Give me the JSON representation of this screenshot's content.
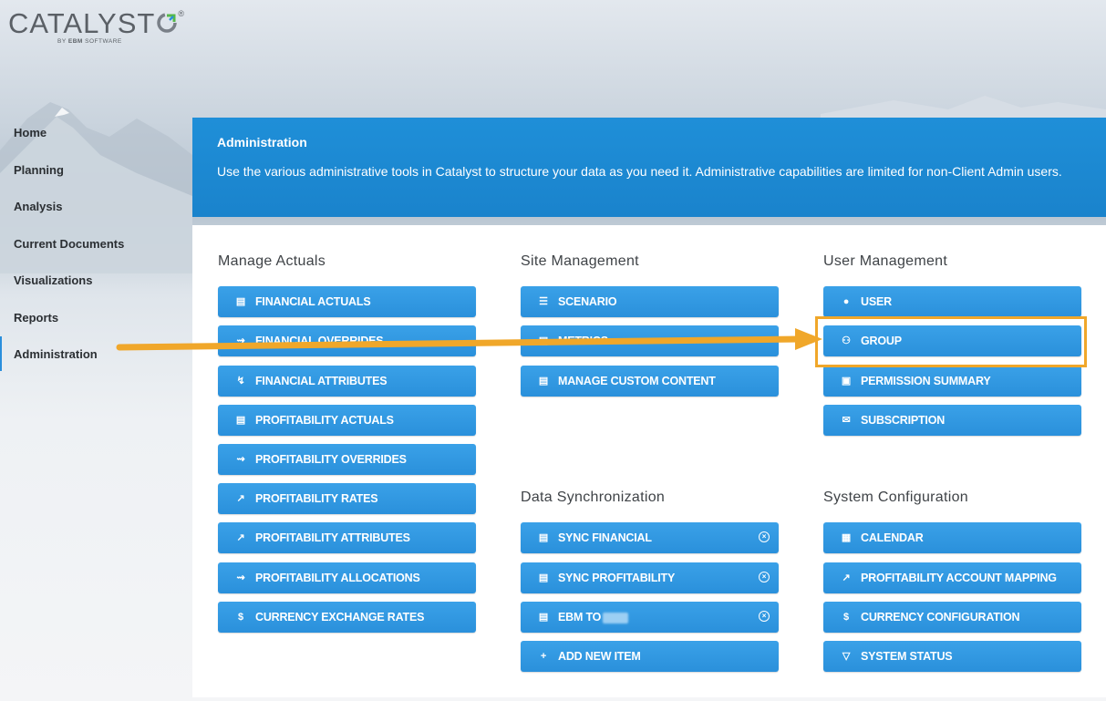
{
  "brand": {
    "name": "CATALYST",
    "registered": "®",
    "byline_prefix": "BY",
    "byline_company": "EBM",
    "byline_suffix": "SOFTWARE"
  },
  "sidebar": {
    "items": [
      {
        "label": "Home"
      },
      {
        "label": "Planning"
      },
      {
        "label": "Analysis"
      },
      {
        "label": "Current Documents"
      },
      {
        "label": "Visualizations"
      },
      {
        "label": "Reports"
      },
      {
        "label": "Administration"
      }
    ],
    "active": "Administration"
  },
  "header": {
    "title": "Administration",
    "description": "Use the various administrative tools in Catalyst to structure your data as you need it. Administrative capabilities are limited for non-Client Admin users."
  },
  "sections": {
    "manage_actuals": {
      "title": "Manage Actuals",
      "items": [
        {
          "label": "FINANCIAL ACTUALS",
          "icon": "list-icon"
        },
        {
          "label": "FINANCIAL OVERRIDES",
          "icon": "override-icon"
        },
        {
          "label": "FINANCIAL ATTRIBUTES",
          "icon": "attribute-icon"
        },
        {
          "label": "PROFITABILITY ACTUALS",
          "icon": "list-icon"
        },
        {
          "label": "PROFITABILITY OVERRIDES",
          "icon": "override-icon"
        },
        {
          "label": "PROFITABILITY RATES",
          "icon": "trend-icon"
        },
        {
          "label": "PROFITABILITY ATTRIBUTES",
          "icon": "trend-icon"
        },
        {
          "label": "PROFITABILITY ALLOCATIONS",
          "icon": "override-icon"
        },
        {
          "label": "CURRENCY EXCHANGE RATES",
          "icon": "currency-icon"
        }
      ]
    },
    "site_management": {
      "title": "Site Management",
      "items": [
        {
          "label": "SCENARIO",
          "icon": "scenario-icon"
        },
        {
          "label": "METRICS",
          "icon": "list-icon"
        },
        {
          "label": "MANAGE CUSTOM CONTENT",
          "icon": "list-icon"
        }
      ]
    },
    "user_management": {
      "title": "User Management",
      "items": [
        {
          "label": "USER",
          "icon": "user-icon"
        },
        {
          "label": "GROUP",
          "icon": "group-icon"
        },
        {
          "label": "PERMISSION SUMMARY",
          "icon": "permission-icon"
        },
        {
          "label": "SUBSCRIPTION",
          "icon": "subscription-icon"
        }
      ]
    },
    "data_sync": {
      "title": "Data Synchronization",
      "items": [
        {
          "label": "SYNC FINANCIAL",
          "icon": "list-icon",
          "removable": true
        },
        {
          "label": "SYNC PROFITABILITY",
          "icon": "list-icon",
          "removable": true
        },
        {
          "label": "EBM TO",
          "icon": "list-icon",
          "removable": true
        },
        {
          "label": "ADD NEW ITEM",
          "icon": "plus-icon"
        }
      ]
    },
    "system_config": {
      "title": "System Configuration",
      "items": [
        {
          "label": "CALENDAR",
          "icon": "calendar-icon"
        },
        {
          "label": "PROFITABILITY ACCOUNT MAPPING",
          "icon": "trend-icon"
        },
        {
          "label": "CURRENCY CONFIGURATION",
          "icon": "currency-icon"
        },
        {
          "label": "SYSTEM STATUS",
          "icon": "status-icon"
        }
      ]
    }
  },
  "colors": {
    "accent": "#2a90db",
    "header_bg": "#1f8fd8",
    "highlight": "#f0a72a",
    "arrow": "#f0a72a"
  }
}
